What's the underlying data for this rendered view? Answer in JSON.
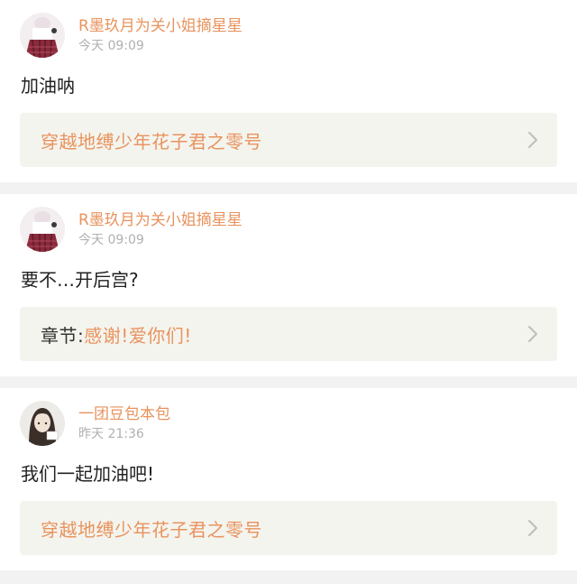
{
  "comments": [
    {
      "username": "R墨玖月为关小姐摘星星",
      "time": "今天 09:09",
      "text": "加油呐",
      "link_prefix": "",
      "link_title": "穿越地缚少年花子君之零号",
      "avatar": "avatar-girl-plaid-skirt"
    },
    {
      "username": "R墨玖月为关小姐摘星星",
      "time": "今天 09:09",
      "text": "要不…开后宫?",
      "link_prefix": "章节:",
      "link_title": "感谢!爱你们!",
      "avatar": "avatar-girl-plaid-skirt"
    },
    {
      "username": "一团豆包本包",
      "time": "昨天 21:36",
      "text": "我们一起加油吧!",
      "link_prefix": "",
      "link_title": "穿越地缚少年花子君之零号",
      "avatar": "avatar-anime-girl"
    }
  ],
  "colors": {
    "accent": "#e8935e",
    "link_bg": "#f4f4ee",
    "page_bg": "#f2f2f2"
  },
  "icons": {
    "link_arrow": "chevron-right-icon"
  }
}
